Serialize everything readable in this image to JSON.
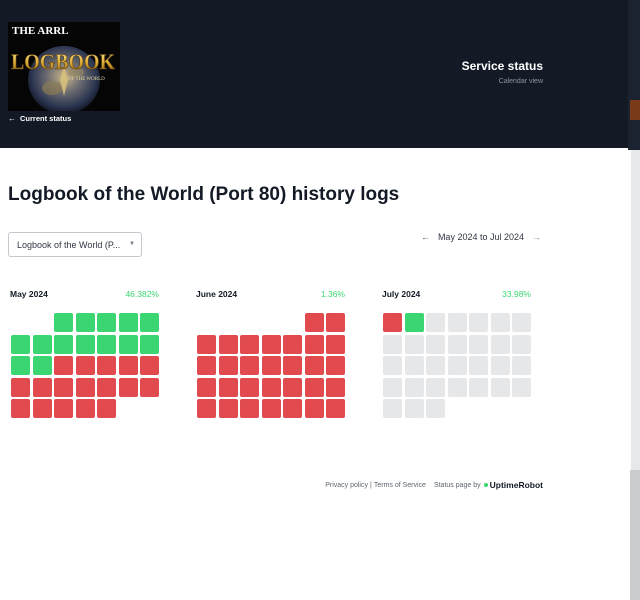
{
  "header": {
    "logo": {
      "line1": "THE ARRL",
      "line2": "LOGBOOK",
      "line3": "OF THE WORLD"
    },
    "back_label": "Current status",
    "title": "Service status",
    "subtitle": "Calendar view"
  },
  "page_title": "Logbook of the World (Port 80) history logs",
  "monitor_select": {
    "value": "Logbook of the World (P..."
  },
  "date_range": {
    "label": "May 2024 to Jul 2024"
  },
  "months": [
    {
      "name": "May 2024",
      "uptime": "46.382%",
      "first_weekday": 2,
      "days": [
        "up",
        "up",
        "up",
        "up",
        "up",
        "up",
        "up",
        "up",
        "up",
        "up",
        "up",
        "up",
        "up",
        "up",
        "down",
        "down",
        "down",
        "down",
        "down",
        "down",
        "down",
        "down",
        "down",
        "down",
        "down",
        "down",
        "down",
        "down",
        "down",
        "down",
        "down"
      ]
    },
    {
      "name": "June 2024",
      "uptime": "1.36%",
      "first_weekday": 5,
      "days": [
        "down",
        "down",
        "down",
        "down",
        "down",
        "down",
        "down",
        "down",
        "down",
        "down",
        "down",
        "down",
        "down",
        "down",
        "down",
        "down",
        "down",
        "down",
        "down",
        "down",
        "down",
        "down",
        "down",
        "down",
        "down",
        "down",
        "down",
        "down",
        "down",
        "down"
      ]
    },
    {
      "name": "July 2024",
      "uptime": "33.98%",
      "first_weekday": 0,
      "days": [
        "down",
        "up",
        "none",
        "none",
        "none",
        "none",
        "none",
        "none",
        "none",
        "none",
        "none",
        "none",
        "none",
        "none",
        "none",
        "none",
        "none",
        "none",
        "none",
        "none",
        "none",
        "none",
        "none",
        "none",
        "none",
        "none",
        "none",
        "none",
        "none",
        "none",
        "none"
      ]
    }
  ],
  "footer": {
    "privacy": "Privacy policy",
    "separator": "|",
    "terms": "Terms of Service",
    "status_by": "Status page by",
    "brand": "UptimeRobot"
  },
  "colors": {
    "header_bg": "#131a26",
    "up": "#3bd671",
    "down": "#e14b50",
    "no_data": "#e6e7e9"
  }
}
